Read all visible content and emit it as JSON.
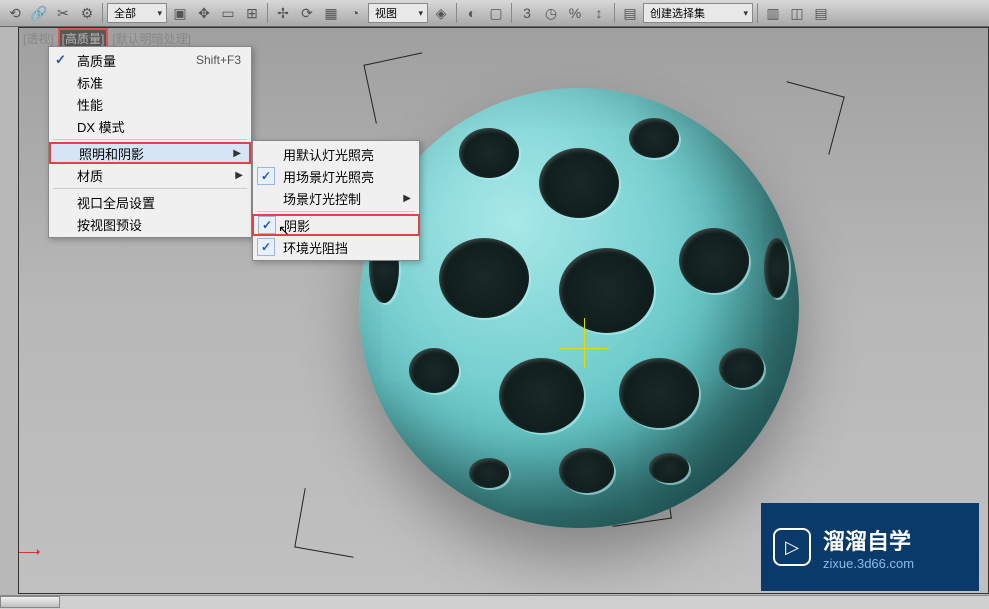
{
  "toolbar": {
    "filter_dropdown": "全部",
    "view_dropdown": "视图",
    "selection_dropdown": "创建选择集"
  },
  "viewport_labels": {
    "perspective": "[透视]",
    "quality": "[高质量]",
    "shading": "[默认明暗处理]"
  },
  "menu1": {
    "items": [
      {
        "label": "高质量",
        "checked": true,
        "shortcut": "Shift+F3"
      },
      {
        "label": "标准"
      },
      {
        "label": "性能"
      },
      {
        "label": "DX 模式"
      },
      {
        "label": "照明和阴影",
        "submenu": true,
        "boxed": true
      },
      {
        "label": "材质",
        "submenu": true
      },
      {
        "label": "视口全局设置"
      },
      {
        "label": "按视图预设"
      }
    ]
  },
  "menu2": {
    "items": [
      {
        "label": "用默认灯光照亮"
      },
      {
        "label": "用场景灯光照亮",
        "checked": true
      },
      {
        "label": "场景灯光控制",
        "submenu": true
      },
      {
        "label": "阴影",
        "checked": true,
        "boxed": true
      },
      {
        "label": "环境光阻挡",
        "checked": true
      }
    ]
  },
  "watermark": {
    "title": "溜溜自学",
    "sub": "zixue.3d66.com"
  }
}
